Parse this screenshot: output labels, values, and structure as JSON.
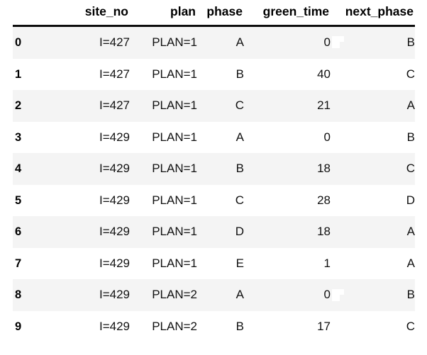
{
  "table": {
    "index_header": "",
    "columns": [
      "site_no",
      "plan",
      "phase",
      "green_time",
      "next_phase"
    ],
    "rows": [
      {
        "index": "0",
        "site_no": "I=427",
        "plan": "PLAN=1",
        "phase": "A",
        "green_time": "0",
        "next_phase": "B"
      },
      {
        "index": "1",
        "site_no": "I=427",
        "plan": "PLAN=1",
        "phase": "B",
        "green_time": "40",
        "next_phase": "C"
      },
      {
        "index": "2",
        "site_no": "I=427",
        "plan": "PLAN=1",
        "phase": "C",
        "green_time": "21",
        "next_phase": "A"
      },
      {
        "index": "3",
        "site_no": "I=429",
        "plan": "PLAN=1",
        "phase": "A",
        "green_time": "0",
        "next_phase": "B"
      },
      {
        "index": "4",
        "site_no": "I=429",
        "plan": "PLAN=1",
        "phase": "B",
        "green_time": "18",
        "next_phase": "C"
      },
      {
        "index": "5",
        "site_no": "I=429",
        "plan": "PLAN=1",
        "phase": "C",
        "green_time": "28",
        "next_phase": "D"
      },
      {
        "index": "6",
        "site_no": "I=429",
        "plan": "PLAN=1",
        "phase": "D",
        "green_time": "18",
        "next_phase": "A"
      },
      {
        "index": "7",
        "site_no": "I=429",
        "plan": "PLAN=1",
        "phase": "E",
        "green_time": "1",
        "next_phase": "A"
      },
      {
        "index": "8",
        "site_no": "I=429",
        "plan": "PLAN=2",
        "phase": "A",
        "green_time": "0",
        "next_phase": "B"
      },
      {
        "index": "9",
        "site_no": "I=429",
        "plan": "PLAN=2",
        "phase": "B",
        "green_time": "17",
        "next_phase": "C"
      }
    ],
    "colors": {
      "stripe": "#f4f4f4",
      "background": "#ffffff",
      "header_rule": "#0d0d0d",
      "text": "#111111"
    }
  }
}
